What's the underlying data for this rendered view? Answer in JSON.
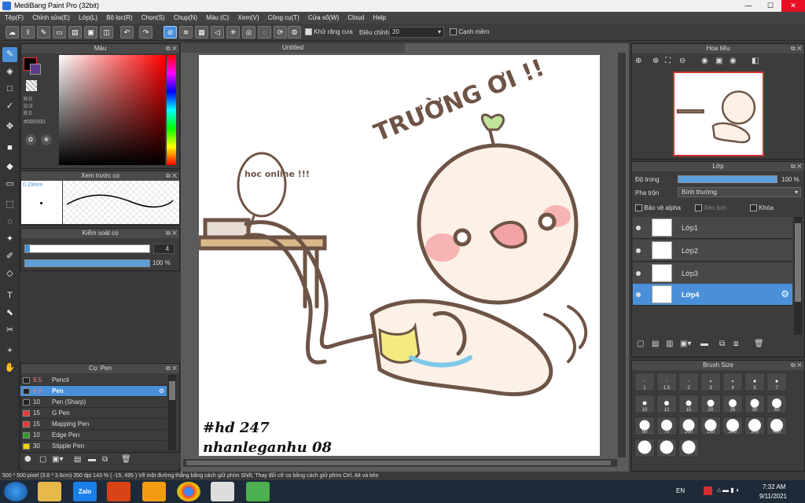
{
  "window": {
    "title": "MediBang Paint Pro (32bit)",
    "min": "—",
    "max": "☐",
    "close": "✕"
  },
  "menu": [
    "Tệp(F)",
    "Chỉnh sửa(E)",
    "Lớp(L)",
    "Bộ lọc(R)",
    "Chọn(S)",
    "Chụp(N)",
    "Màu (C)",
    "Xem(V)",
    "Công cụ(T)",
    "Cửa sổ(W)",
    "Cloud",
    "Help"
  ],
  "toolbar": {
    "antialias_label": "Khử răng cưa",
    "adjust_label": "Điều chỉnh",
    "adjust_value": "20",
    "snap_label": "Cạnh mềm"
  },
  "color_panel": {
    "title": "Màu",
    "r": "R:0",
    "g": "G:0",
    "b": "B:0",
    "hex": "#000000"
  },
  "brush_preview": {
    "title": "Xem trước cọ",
    "size": "0.29mm"
  },
  "brush_control": {
    "title": "Kiểm soát cọ",
    "size_value": "4",
    "opacity_value": "100 %",
    "opacity_fraction": 1.0
  },
  "brush_list": {
    "title": "Cọ: Pen",
    "items": [
      {
        "size": "9.5",
        "name": "Pencil",
        "color": "#222222"
      },
      {
        "size": "4.0",
        "name": "Pen",
        "color": "#222222"
      },
      {
        "size": "10",
        "name": "Pen (Sharp)",
        "color": "#222222"
      },
      {
        "size": "15",
        "name": "G Pen",
        "color": "#e53935"
      },
      {
        "size": "15",
        "name": "Mapping Pen",
        "color": "#e53935"
      },
      {
        "size": "10",
        "name": "Edge Pen",
        "color": "#2e9d2e"
      },
      {
        "size": "30",
        "name": "Stipple Pen",
        "color": "#f0d000"
      }
    ]
  },
  "canvas": {
    "tab_title": "Untitled",
    "drawing_text": {
      "title": "TRƯỜNG ƠI !!",
      "bubble": "hoc online !!!",
      "sig1": "#hd 247",
      "sig2": "nhanleganhu 08"
    }
  },
  "navigator": {
    "title": "Hoa tiêu"
  },
  "layer_panel": {
    "title": "Lớp",
    "opacity_label": "Độ trong",
    "opacity_value": "100 %",
    "opacity_fraction": 1.0,
    "blend_label": "Pha trộn",
    "blend_value": "Bình thường",
    "alpha_label": "Bảo vệ alpha",
    "clip_label": "Xén bớt",
    "lock_label": "Khóa",
    "layers": [
      "Lớp1",
      "Lớp2",
      "Lớp3",
      "Lớp4"
    ]
  },
  "brush_size": {
    "title": "Brush Size",
    "sizes": [
      "1",
      "1.5",
      "2",
      "3",
      "4",
      "5",
      "7",
      "10",
      "12",
      "15",
      "20",
      "25",
      "30",
      "40",
      "50",
      "70",
      "100",
      "150",
      "200",
      "300",
      "400"
    ]
  },
  "status": {
    "text": "500 * 500 pixel   (3.6 * 3.6cm)  350 dpi  143 %  ( -15, 495 )  Vẽ một đường thẳng bằng cách giữ phím Shift, Thay đổi cỡ cọ bằng cách giữ phím Ctrl, Alt và kéo"
  },
  "taskbar": {
    "lang": "EN",
    "time": "7:32 AM",
    "date": "9/11/2021",
    "zalo": "Zalo"
  }
}
